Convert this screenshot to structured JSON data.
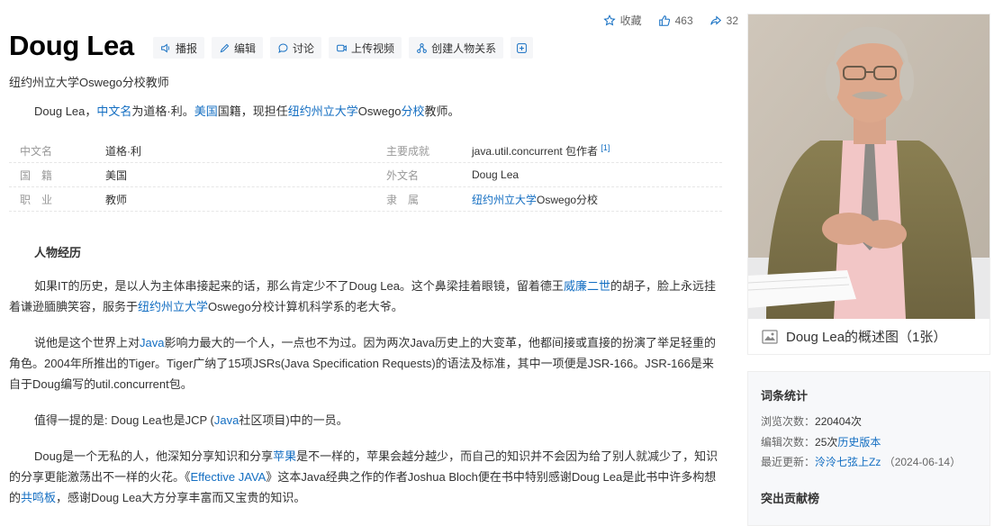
{
  "header": {
    "favorite_label": "收藏",
    "like_count": "463",
    "share_count": "32"
  },
  "title": "Doug Lea",
  "toolbar": {
    "play": "播报",
    "edit": "编辑",
    "discuss": "讨论",
    "upload_video": "上传视频",
    "create_relation": "创建人物关系",
    "plus": "+"
  },
  "subtitle": "纽约州立大学Oswego分校教师",
  "summary": {
    "t1": "Doug Lea，",
    "l1": "中文名",
    "t2": "为道格·利。",
    "l2": "美国",
    "t3": "国籍，现担任",
    "l3": "纽约州立大学",
    "t4": "Oswego",
    "l4": "分校",
    "t5": "教师。"
  },
  "info": {
    "rows": [
      {
        "k1": "中文名",
        "v1": "道格·利",
        "k2": "主要成就",
        "v2": "java.util.concurrent 包作者",
        "sup": "[1]"
      },
      {
        "k1": "国　籍",
        "v1": "美国",
        "k2": "外文名",
        "v2": "Doug Lea"
      },
      {
        "k1": "职　业",
        "v1": "教师",
        "k2": "隶　属",
        "v2a": "纽约州立大学",
        "v2b": "Oswego分校"
      }
    ]
  },
  "article": {
    "section": "人物经历",
    "p1": {
      "a": "如果IT的历史，是以人为主体串接起来的话，那么肯定少不了Doug Lea。这个鼻梁挂着眼镜，留着德王",
      "l1": "威廉二世",
      "b": "的胡子，脸上永远挂着谦逊腼腆笑容，服务于",
      "l2": "纽约州立大学",
      "c": "Oswego分校计算机科学系的老大爷。"
    },
    "p2": {
      "a": "说他是这个世界上对",
      "l1": "Java",
      "b": "影响力最大的一个人，一点也不为过。因为两次Java历史上的大变革，他都间接或直接的扮演了举足轻重的角色。2004年所推出的Tiger。Tiger广纳了15项JSRs(Java Specification Requests)的语法及标准，其中一项便是JSR-166。JSR-166是来自于Doug编写的util.concurrent包。"
    },
    "p3": {
      "a": "值得一提的是: Doug Lea也是JCP (",
      "l1": "Java",
      "b": "社区项目)中的一员。"
    },
    "p4": {
      "a": "Doug是一个无私的人，他深知分享知识和分享",
      "l1": "苹果",
      "b": "是不一样的，苹果会越分越少，而自己的知识并不会因为给了别人就减少了，知识的分享更能激荡出不一样的火花。《",
      "l2": "Effective JAVA",
      "c": "》这本Java经典之作的作者Joshua Bloch便在书中特别感谢Doug Lea是此书中许多构想的",
      "l3": "共鸣板",
      "d": "，感谢Doug Lea大方分享丰富而又宝贵的知识。"
    }
  },
  "photo_caption": "Doug Lea的概述图（1张）",
  "stats_card": {
    "title": "词条统计",
    "views_label": "浏览次数：",
    "views": "220404次",
    "edits_label": "编辑次数：",
    "edits": "25次",
    "history": "历史版本",
    "updated_label": "最近更新：",
    "updated_by": "泠泠七弦上Zz",
    "updated_date": "（2024-06-14）",
    "contrib_title": "突出贡献榜"
  }
}
